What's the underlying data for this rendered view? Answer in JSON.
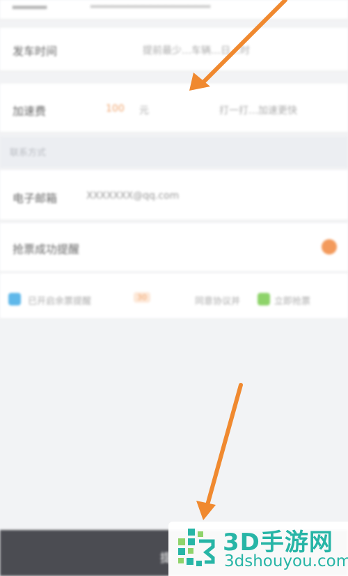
{
  "rows": {
    "top_partial": {
      "label": "",
      "value": ""
    },
    "row1": {
      "label": "发车时间",
      "value": "提前最少…车辆…日…时"
    },
    "row2": {
      "label": "加速费",
      "value_accent": "100",
      "value_unit": "元",
      "hint": "打一打…加速更快"
    }
  },
  "section": {
    "title": "联系方式"
  },
  "contact": {
    "label": "电子邮箱",
    "value": "XXXXXXX@qq.com"
  },
  "alert": {
    "label": "抢票成功提醒"
  },
  "options": {
    "opt1_label": "已开启余票提醒",
    "opt1_badge": "30",
    "opt2_label": "同意协议并",
    "opt3_label": "立即抢票"
  },
  "bottom_bar": {
    "label": "提"
  },
  "colors": {
    "arrow": "#f0892f",
    "accent": "#f39a5c",
    "bar": "#4b4c52",
    "watermark": "#27b5a6"
  },
  "watermark": {
    "title": "3D手游网",
    "domain": "3dshouyou.com"
  }
}
